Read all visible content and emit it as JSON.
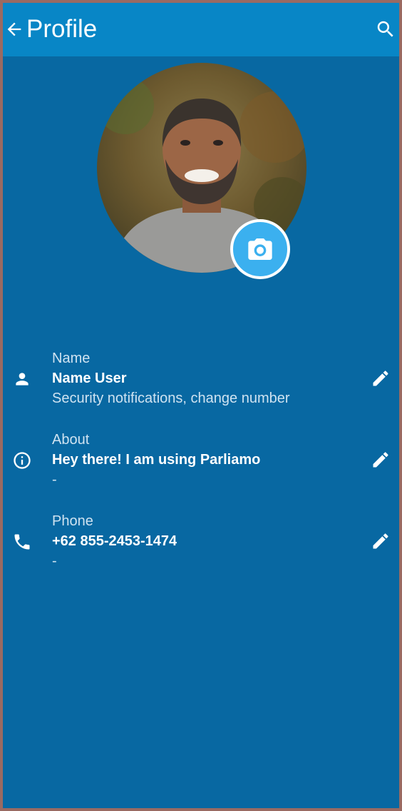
{
  "appbar": {
    "title": "Profile",
    "back_icon": "arrow-back-icon",
    "search_icon": "search-icon"
  },
  "avatar": {
    "camera_icon": "camera-icon"
  },
  "rows": [
    {
      "icon": "person-icon",
      "label": "Name",
      "value": "Name User",
      "sub": "Security notifications, change number",
      "action_icon": "edit-pencil-icon"
    },
    {
      "icon": "info-icon",
      "label": "About",
      "value": "Hey there! I am using Parliamo",
      "sub": "-",
      "action_icon": "edit-pencil-icon"
    },
    {
      "icon": "phone-icon",
      "label": "Phone",
      "value": "+62 855-2453-1474",
      "sub": "-",
      "action_icon": "edit-pencil-icon"
    }
  ],
  "colors": {
    "appbar": "#0886c6",
    "background": "#0868a2",
    "camera_button": "#3bb0ef",
    "text": "#ffffff",
    "secondary_text": "#cfe3f1"
  }
}
